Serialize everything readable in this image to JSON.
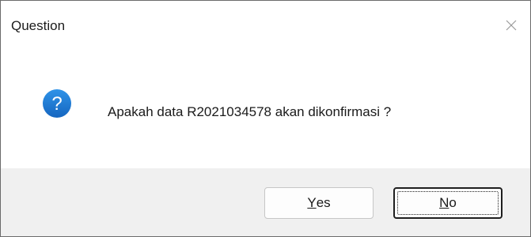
{
  "dialog": {
    "title": "Question",
    "message": "Apakah data R2021034578 akan dikonfirmasi  ?",
    "icon": "question-icon",
    "buttons": {
      "yes": {
        "mnemonic": "Y",
        "rest": "es"
      },
      "no": {
        "mnemonic": "N",
        "rest": "o"
      }
    },
    "default_button": "No"
  },
  "colors": {
    "icon_blue": "#1a7fd6",
    "footer_bg": "#f0f0f0"
  }
}
